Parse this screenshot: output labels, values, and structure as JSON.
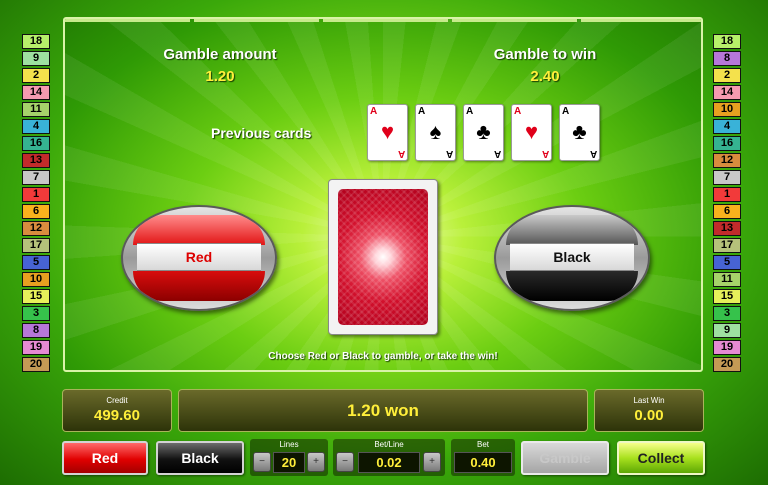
{
  "lines_left": [
    {
      "n": "18",
      "color": "#b7f06a"
    },
    {
      "n": "9",
      "color": "#9ee0a0"
    },
    {
      "n": "2",
      "color": "#f4e14c"
    },
    {
      "n": "14",
      "color": "#f59ab0"
    },
    {
      "n": "11",
      "color": "#a6d36a"
    },
    {
      "n": "4",
      "color": "#39b2d8"
    },
    {
      "n": "16",
      "color": "#35b391"
    },
    {
      "n": "13",
      "color": "#c22b2b"
    },
    {
      "n": "7",
      "color": "#c8c8c8"
    },
    {
      "n": "1",
      "color": "#f23a3a"
    },
    {
      "n": "6",
      "color": "#f9b21d"
    },
    {
      "n": "12",
      "color": "#d88c3e"
    },
    {
      "n": "17",
      "color": "#b5c27a"
    },
    {
      "n": "5",
      "color": "#4763d4"
    },
    {
      "n": "10",
      "color": "#e8a020"
    },
    {
      "n": "15",
      "color": "#e6f05a"
    },
    {
      "n": "3",
      "color": "#36c24b"
    },
    {
      "n": "8",
      "color": "#b677d8"
    },
    {
      "n": "19",
      "color": "#e58ad3"
    },
    {
      "n": "20",
      "color": "#c59a55"
    }
  ],
  "lines_right": [
    {
      "n": "18",
      "color": "#b7f06a"
    },
    {
      "n": "8",
      "color": "#b677d8"
    },
    {
      "n": "2",
      "color": "#f4e14c"
    },
    {
      "n": "14",
      "color": "#f59ab0"
    },
    {
      "n": "10",
      "color": "#e8a020"
    },
    {
      "n": "4",
      "color": "#39b2d8"
    },
    {
      "n": "16",
      "color": "#35b391"
    },
    {
      "n": "12",
      "color": "#d88c3e"
    },
    {
      "n": "7",
      "color": "#c8c8c8"
    },
    {
      "n": "1",
      "color": "#f23a3a"
    },
    {
      "n": "6",
      "color": "#f9b21d"
    },
    {
      "n": "13",
      "color": "#c22b2b"
    },
    {
      "n": "17",
      "color": "#b5c27a"
    },
    {
      "n": "5",
      "color": "#4763d4"
    },
    {
      "n": "11",
      "color": "#a6d36a"
    },
    {
      "n": "15",
      "color": "#e6f05a"
    },
    {
      "n": "3",
      "color": "#36c24b"
    },
    {
      "n": "9",
      "color": "#9ee0a0"
    },
    {
      "n": "19",
      "color": "#e58ad3"
    },
    {
      "n": "20",
      "color": "#c59a55"
    }
  ],
  "gamble": {
    "amount_label": "Gamble amount",
    "amount_value": "1.20",
    "to_win_label": "Gamble to win",
    "to_win_value": "2.40",
    "previous_label": "Previous cards",
    "previous_cards": [
      {
        "rank": "A",
        "suit": "♥",
        "color": "red"
      },
      {
        "rank": "A",
        "suit": "♠",
        "color": "black"
      },
      {
        "rank": "A",
        "suit": "♣",
        "color": "black"
      },
      {
        "rank": "A",
        "suit": "♥",
        "color": "red"
      },
      {
        "rank": "A",
        "suit": "♣",
        "color": "black"
      }
    ],
    "red_label": "Red",
    "black_label": "Black",
    "hint": "Choose Red or Black to gamble, or take the win!"
  },
  "info": {
    "credit_label": "Credit",
    "credit_value": "499.60",
    "win_text": "1.20 won",
    "last_win_label": "Last Win",
    "last_win_value": "0.00"
  },
  "controls": {
    "red_label": "Red",
    "black_label": "Black",
    "lines_label": "Lines",
    "lines_value": "20",
    "bet_line_label": "Bet/Line",
    "bet_line_value": "0.02",
    "bet_label": "Bet",
    "bet_value": "0.40",
    "gamble_label": "Gamble",
    "collect_label": "Collect",
    "minus_glyph": "−",
    "plus_glyph": "+"
  },
  "colors": {
    "accent_yellow": "#ffef3a",
    "red_choice": "#e00000",
    "black_choice": "#111111",
    "collect_green": "#a9e11e"
  }
}
